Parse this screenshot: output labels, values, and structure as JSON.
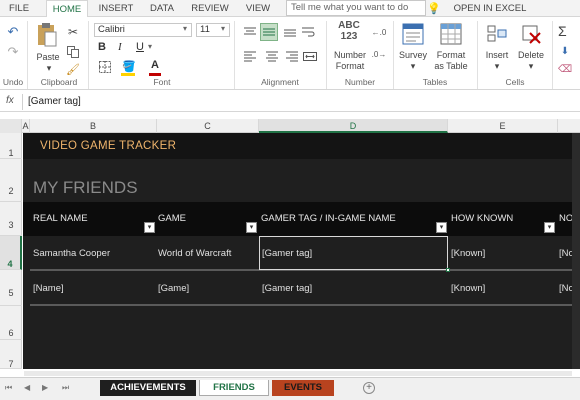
{
  "ribbon_tabs": [
    "FILE",
    "HOME",
    "INSERT",
    "DATA",
    "REVIEW",
    "VIEW"
  ],
  "active_tab": "HOME",
  "tell_me": "Tell me what you want to do",
  "open_in_excel": "OPEN IN EXCEL",
  "ribbon": {
    "paste": "Paste",
    "font_name": "Calibri",
    "font_size": "11",
    "bold": "B",
    "italic": "I",
    "underline": "U",
    "font_color": "A",
    "number_abc": "ABC",
    "number_123": "123",
    "number_format_1": "Number",
    "number_format_2": "Format",
    "survey": "Survey",
    "format_table_1": "Format",
    "format_table_2": "as Table",
    "insert": "Insert",
    "delete": "Delete",
    "sum": "Σ",
    "groups": {
      "undo": "Undo",
      "clipboard": "Clipboard",
      "font": "Font",
      "alignment": "Alignment",
      "number": "Number",
      "tables": "Tables",
      "cells": "Cells"
    }
  },
  "formula_bar": {
    "fx": "fx",
    "value": "[Gamer tag]"
  },
  "columns": [
    "A",
    "B",
    "C",
    "D",
    "E"
  ],
  "selected_column": "D",
  "rows": [
    "1",
    "2",
    "3",
    "4",
    "5",
    "6",
    "7"
  ],
  "selected_row": "4",
  "sheet": {
    "title": "VIDEO GAME TRACKER",
    "subtitle": "MY FRIENDS",
    "headers": [
      "REAL NAME",
      "GAME",
      "GAMER TAG / IN-GAME NAME",
      "HOW KNOWN",
      "NO"
    ],
    "data_rows": [
      [
        "Samantha Cooper",
        "World of Warcraft",
        "[Gamer tag]",
        "[Known]",
        "[No"
      ],
      [
        "[Name]",
        "[Game]",
        "[Gamer tag]",
        "[Known]",
        "[No"
      ]
    ]
  },
  "sheet_tabs": [
    {
      "name": "ACHIEVEMENTS",
      "color": "#1f1f1f"
    },
    {
      "name": "FRIENDS",
      "color": "#ffffff"
    },
    {
      "name": "EVENTS",
      "color": "#b8431f"
    }
  ],
  "active_sheet": "FRIENDS",
  "colors": {
    "accent": "#217346",
    "title": "#f0b56c",
    "sheet_bg": "#1f1f1f"
  }
}
